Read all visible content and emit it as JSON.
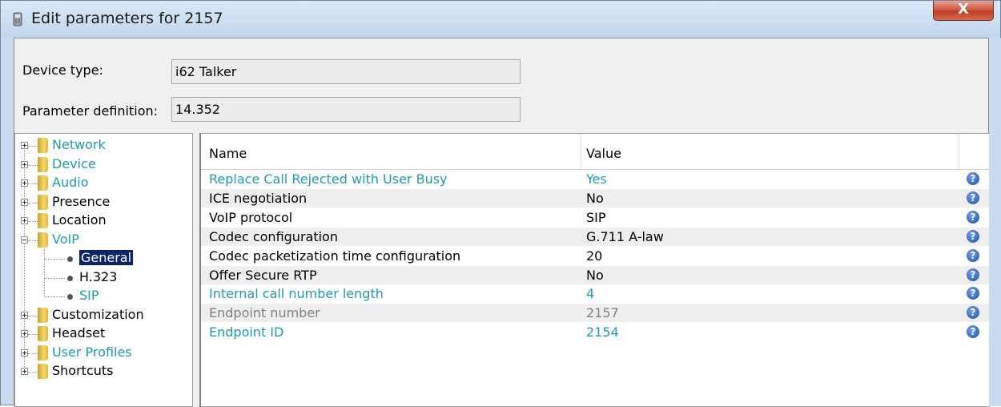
{
  "window": {
    "title": "Edit parameters for 2157",
    "close_label": "X"
  },
  "fields": {
    "device_type_label": "Device type:",
    "device_type_value": "i62 Talker",
    "param_def_label": "Parameter definition:",
    "param_def_value": "14.352"
  },
  "tree": [
    {
      "label": "Network",
      "highlighted": true
    },
    {
      "label": "Device",
      "highlighted": true
    },
    {
      "label": "Audio",
      "highlighted": true
    },
    {
      "label": "Presence",
      "highlighted": false
    },
    {
      "label": "Location",
      "highlighted": false
    },
    {
      "label": "VoIP",
      "highlighted": true,
      "expanded": true,
      "children": [
        {
          "label": "General",
          "selected": true
        },
        {
          "label": "H.323",
          "highlighted": false
        },
        {
          "label": "SIP",
          "highlighted": true
        }
      ]
    },
    {
      "label": "Customization",
      "highlighted": false
    },
    {
      "label": "Headset",
      "highlighted": false
    },
    {
      "label": "User Profiles",
      "highlighted": true
    },
    {
      "label": "Shortcuts",
      "highlighted": false
    }
  ],
  "grid": {
    "headers": {
      "name": "Name",
      "value": "Value"
    },
    "help_icon": "?",
    "rows": [
      {
        "name": "Replace Call Rejected with User Busy",
        "value": "Yes",
        "state": "changed"
      },
      {
        "name": "ICE negotiation",
        "value": "No",
        "state": "normal"
      },
      {
        "name": "VoIP protocol",
        "value": "SIP",
        "state": "normal"
      },
      {
        "name": "Codec configuration",
        "value": "G.711 A-law",
        "state": "normal"
      },
      {
        "name": "Codec packetization time configuration",
        "value": "20",
        "state": "normal"
      },
      {
        "name": "Offer Secure RTP",
        "value": "No",
        "state": "normal"
      },
      {
        "name": "Internal call number length",
        "value": "4",
        "state": "changed"
      },
      {
        "name": "Endpoint number",
        "value": "2157",
        "state": "disabled"
      },
      {
        "name": "Endpoint ID",
        "value": "2154",
        "state": "changed"
      }
    ]
  },
  "colors": {
    "changed": "#1f9ca8",
    "disabled": "#808080",
    "normal": "#000000",
    "row_alt": "#eeeeee",
    "selection": "#0a246a"
  }
}
